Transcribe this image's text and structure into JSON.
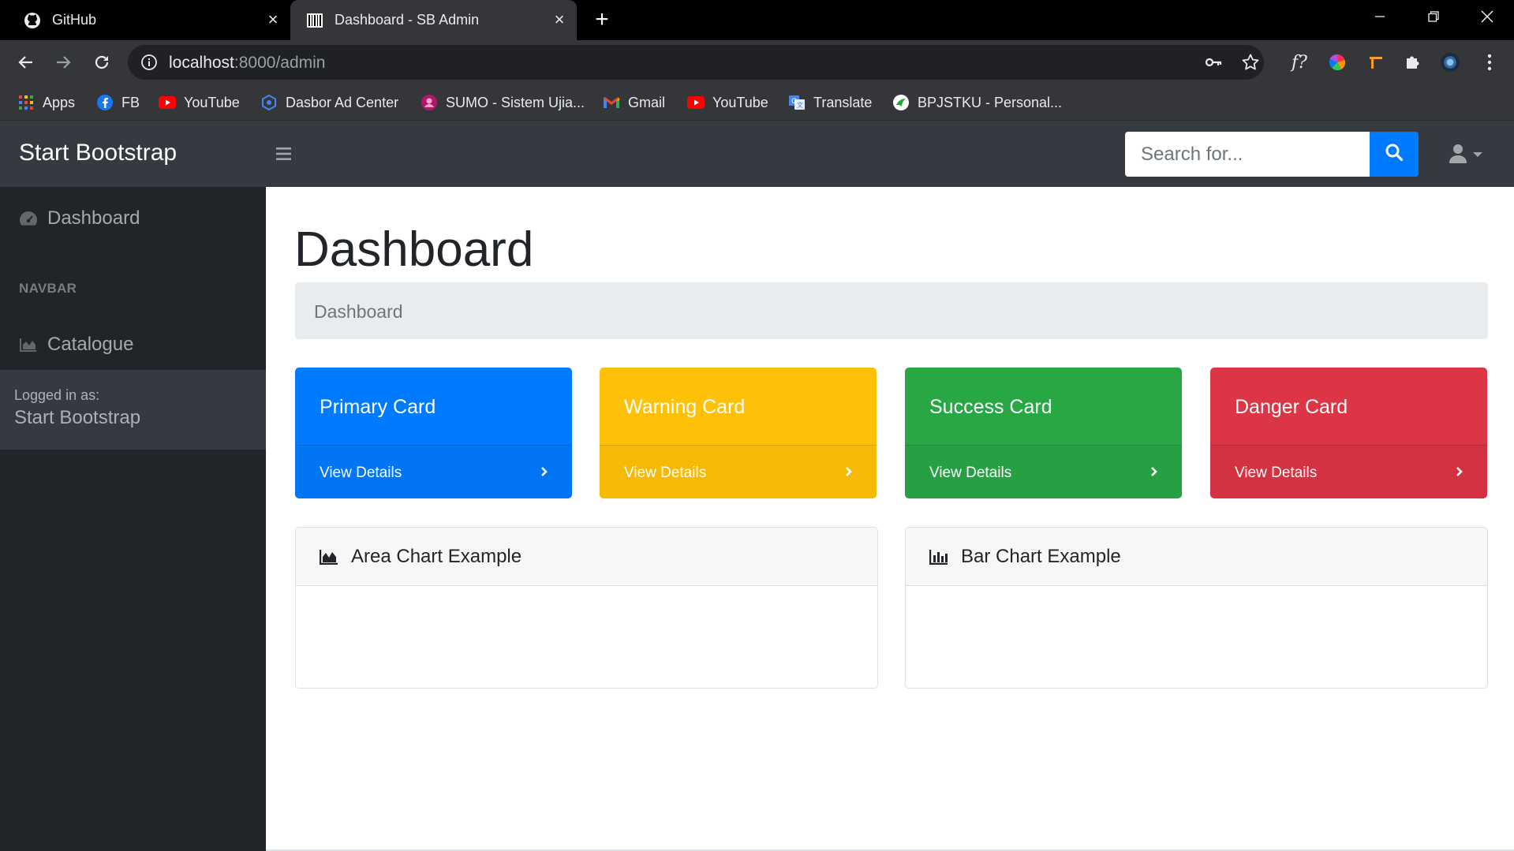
{
  "browser": {
    "tabs": [
      {
        "title": "GitHub",
        "icon": "github-icon",
        "active": false
      },
      {
        "title": "Dashboard - SB Admin",
        "icon": "barcode-icon",
        "active": true
      }
    ],
    "address": {
      "host": "localhost",
      "path": ":8000/admin"
    },
    "bookmarks": [
      {
        "label": "Apps",
        "icon": "apps-grid-icon"
      },
      {
        "label": "FB",
        "icon": "facebook-icon"
      },
      {
        "label": "YouTube",
        "icon": "youtube-icon"
      },
      {
        "label": "Dasbor Ad Center",
        "icon": "ad-center-icon"
      },
      {
        "label": "SUMO - Sistem Ujia...",
        "icon": "sumo-icon"
      },
      {
        "label": "Gmail",
        "icon": "gmail-icon"
      },
      {
        "label": "YouTube",
        "icon": "youtube-icon"
      },
      {
        "label": "Translate",
        "icon": "translate-icon"
      },
      {
        "label": "BPJSTKU - Personal...",
        "icon": "bpjstku-icon"
      }
    ],
    "extension_text": "f?"
  },
  "app": {
    "brand": "Start Bootstrap",
    "search": {
      "placeholder": "Search for..."
    },
    "sidebar": {
      "dashboard_label": "Dashboard",
      "heading": "NAVBAR",
      "catalogue_label": "Catalogue",
      "footer_small": "Logged in as:",
      "footer_name": "Start Bootstrap"
    },
    "main": {
      "title": "Dashboard",
      "breadcrumb": "Dashboard",
      "cards": [
        {
          "title": "Primary Card",
          "link": "View Details",
          "color": "#007bff"
        },
        {
          "title": "Warning Card",
          "link": "View Details",
          "color": "#ffc107"
        },
        {
          "title": "Success Card",
          "link": "View Details",
          "color": "#28a745"
        },
        {
          "title": "Danger Card",
          "link": "View Details",
          "color": "#dc3545"
        }
      ],
      "charts": [
        {
          "title": "Area Chart Example",
          "icon": "area-chart-icon"
        },
        {
          "title": "Bar Chart Example",
          "icon": "bar-chart-icon"
        }
      ]
    }
  }
}
